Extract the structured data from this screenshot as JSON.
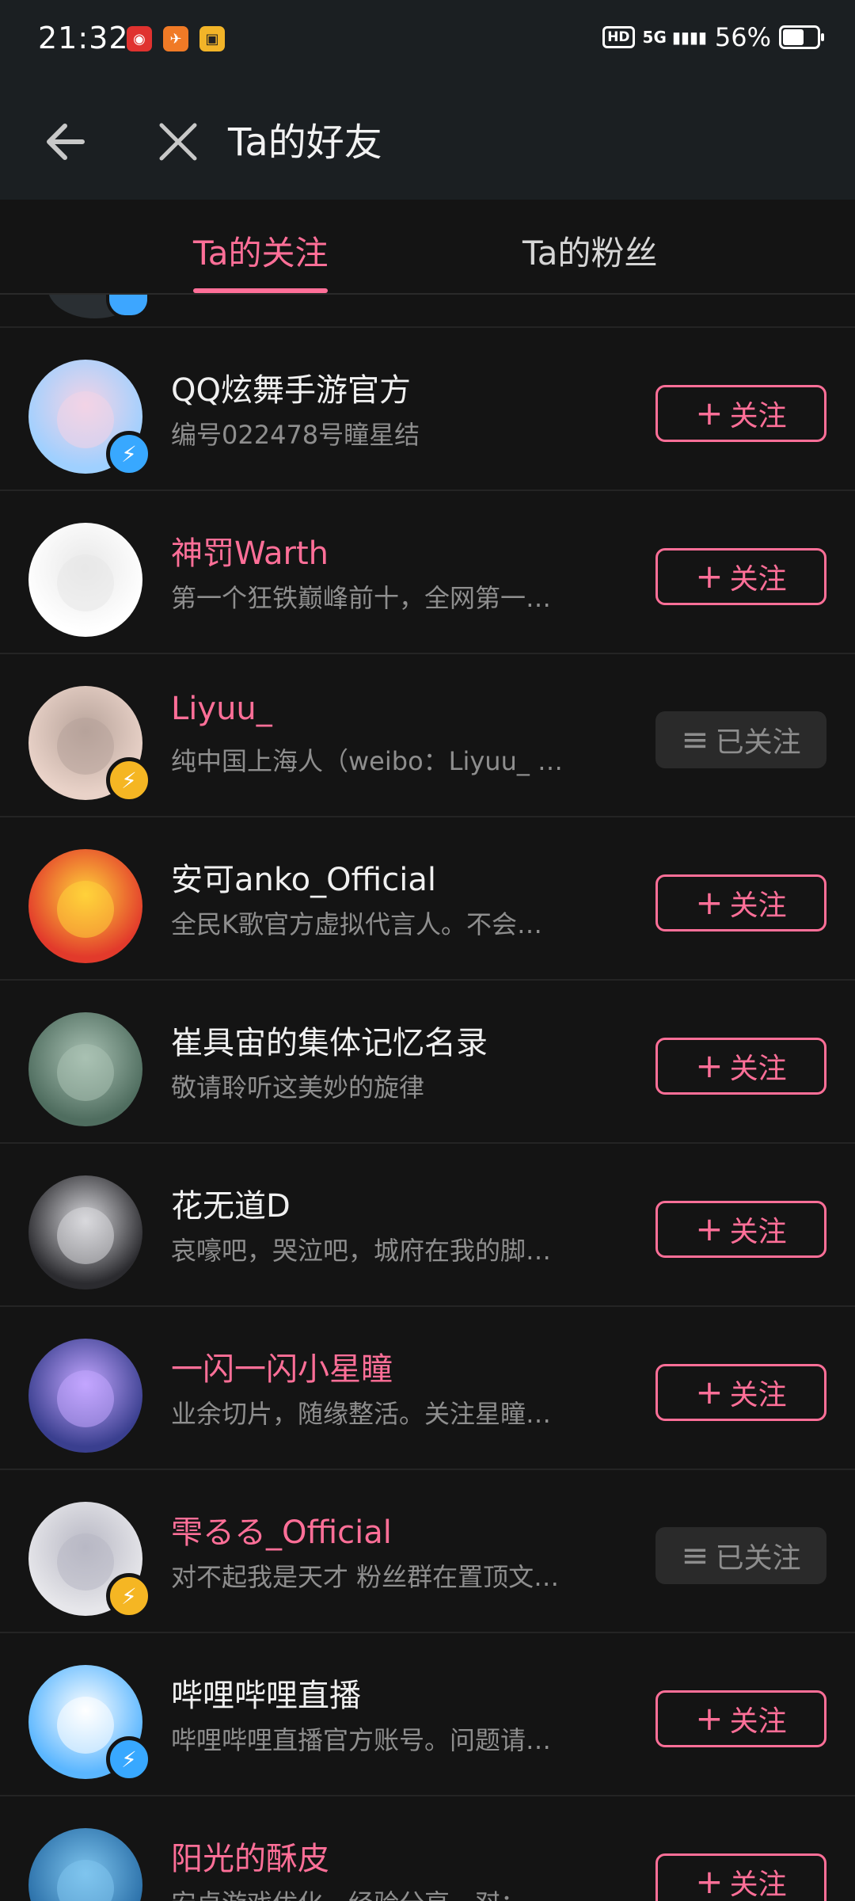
{
  "status_bar": {
    "time": "21:32",
    "network": "5G",
    "battery_percent": "56%",
    "battery_level": 0.56,
    "app_icons": [
      "netease-music-icon",
      "bird-app-icon",
      "bilibili-tv-icon"
    ]
  },
  "header": {
    "title": "Ta的好友"
  },
  "tabs": [
    {
      "label": "Ta的关注",
      "active": true
    },
    {
      "label": "Ta的粉丝",
      "active": false
    }
  ],
  "colors": {
    "accent": "#ff6f98",
    "background": "#141414",
    "verified_blue": "#38a8ff",
    "verified_gold": "#f5b623"
  },
  "buttons": {
    "follow": "关注",
    "followed": "已关注"
  },
  "users": [
    {
      "name": "QQ炫舞手游官方",
      "bio": "编号022478号瞳星结",
      "name_highlight": false,
      "badge": "blue",
      "followed": false
    },
    {
      "name": "神罚Warth",
      "bio": "第一个狂铁巅峰前十，全网第一…",
      "name_highlight": true,
      "badge": "none",
      "followed": false
    },
    {
      "name": "Liyuu_",
      "bio": "纯中国上海人（weibo：Liyuu_ …",
      "name_highlight": true,
      "badge": "gold",
      "followed": true
    },
    {
      "name": "安可anko_Official",
      "bio": "全民K歌官方虚拟代言人。不会…",
      "name_highlight": false,
      "badge": "none",
      "followed": false
    },
    {
      "name": "崔具宙的集体记忆名录",
      "bio": "敬请聆听这美妙的旋律",
      "name_highlight": false,
      "badge": "none",
      "followed": false
    },
    {
      "name": "花无道D",
      "bio": "哀嚎吧，哭泣吧，城府在我的脚…",
      "name_highlight": false,
      "badge": "none",
      "followed": false
    },
    {
      "name": "一闪一闪小星瞳",
      "bio": "业余切片，随缘整活。关注星瞳…",
      "name_highlight": true,
      "badge": "none",
      "followed": false
    },
    {
      "name": "雫るる_Official",
      "bio": "对不起我是天才 粉丝群在置顶文…",
      "name_highlight": true,
      "badge": "gold",
      "followed": true
    },
    {
      "name": "哔哩哔哩直播",
      "bio": "哔哩哔哩直播官方账号。问题请…",
      "name_highlight": false,
      "badge": "blue",
      "followed": false
    },
    {
      "name": "阳光的酥皮",
      "bio": "安卓游戏优化，经验分享。怼：…",
      "name_highlight": true,
      "badge": "none",
      "followed": false
    }
  ]
}
